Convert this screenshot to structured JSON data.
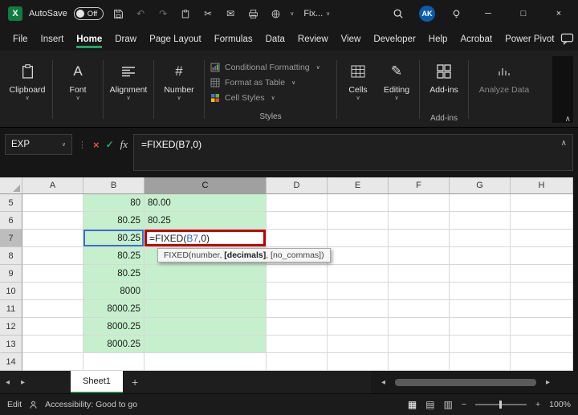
{
  "colors": {
    "accent_green": "#107C41",
    "underline_green": "#21A366",
    "cell_fill_green": "#C6EFCE",
    "reference_blue": "#4472C4",
    "annotation_red": "#C00000",
    "avatar_blue": "#0B5CAB"
  },
  "icons": {
    "undo": "↶",
    "redo": "↷",
    "cut": "✂",
    "mail": "✉",
    "dropdown": "∨",
    "collapse": "∧",
    "dots": "⋮",
    "minimize": "─",
    "maximize": "□",
    "close": "×",
    "font": "A",
    "number": "#",
    "pencil": "✎",
    "view_normal": "▦",
    "view_layout": "▤",
    "view_break": "▥",
    "scroll_left": "◂",
    "scroll_right": "▸",
    "tab_prev": "◂",
    "tab_next": "▸",
    "add_sheet": "+",
    "zoom_out": "−",
    "zoom_in": "+",
    "share_arrow": "↗",
    "cancel": "×",
    "enter": "✓",
    "fx": "fx"
  },
  "titlebar": {
    "app": "X",
    "autosave_label": "AutoSave",
    "autosave_state": "Off",
    "qat_dropdown_label": "Fix...",
    "avatar": "AK"
  },
  "menubar": {
    "items": [
      "File",
      "Insert",
      "Home",
      "Draw",
      "Page Layout",
      "Formulas",
      "Data",
      "Review",
      "View",
      "Developer",
      "Help",
      "Acrobat",
      "Power Pivot"
    ]
  },
  "ribbon": {
    "clipboard_label": "Clipboard",
    "font_label": "Font",
    "alignment_label": "Alignment",
    "number_label": "Number",
    "styles_items": [
      "Conditional Formatting",
      "Format as Table",
      "Cell Styles"
    ],
    "styles_label": "Styles",
    "cells_label": "Cells",
    "editing_label": "Editing",
    "addins_label": "Add-ins",
    "addins_group_label": "Add-ins",
    "analyze_label": "Analyze Data"
  },
  "formulabar": {
    "namebox": "EXP",
    "formula": "=FIXED(B7,0)"
  },
  "grid": {
    "columns": [
      "A",
      "B",
      "C",
      "D",
      "E",
      "F",
      "G",
      "H"
    ],
    "rows": [
      {
        "num": "5",
        "b": "80",
        "c": "80.00"
      },
      {
        "num": "6",
        "b": "80.25",
        "c": "80.25"
      },
      {
        "num": "7",
        "b": "80.25"
      },
      {
        "num": "8",
        "b": "80.25",
        "c": ""
      },
      {
        "num": "9",
        "b": "80.25",
        "c": ""
      },
      {
        "num": "10",
        "b": "8000",
        "c": ""
      },
      {
        "num": "11",
        "b": "8000.25",
        "c": ""
      },
      {
        "num": "12",
        "b": "8000.25",
        "c": ""
      },
      {
        "num": "13",
        "b": "8000.25",
        "c": ""
      },
      {
        "num": "14",
        "b": "",
        "c": ""
      }
    ],
    "formula": {
      "pre": "=FIXED(",
      "ref": "B7",
      "post": ",0)"
    }
  },
  "tooltip": {
    "pre": "FIXED(number, ",
    "bold": "[decimals]",
    "post": ", [no_commas])"
  },
  "sheetbar": {
    "tab": "Sheet1"
  },
  "statusbar": {
    "mode": "Edit",
    "accessibility": "Accessibility: Good to go",
    "zoom": "100%"
  }
}
